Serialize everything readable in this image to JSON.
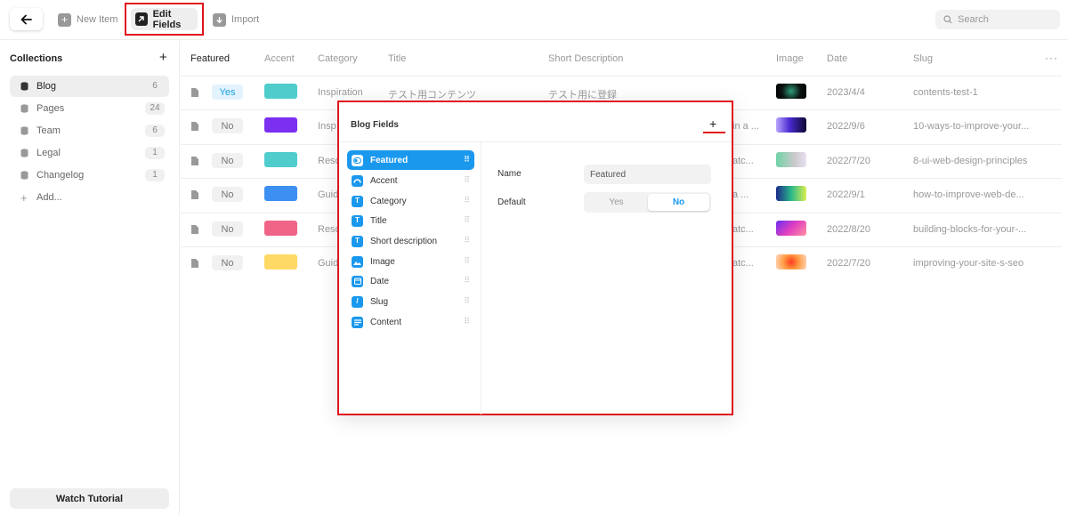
{
  "toolbar": {
    "new_item_label": "New Item",
    "edit_fields_label": "Edit Fields",
    "import_label": "Import",
    "search_placeholder": "Search"
  },
  "sidebar": {
    "heading": "Collections",
    "add_icon": "plus-icon",
    "items": [
      {
        "label": "Blog",
        "count": "6",
        "active": true
      },
      {
        "label": "Pages",
        "count": "24"
      },
      {
        "label": "Team",
        "count": "6"
      },
      {
        "label": "Legal",
        "count": "1"
      },
      {
        "label": "Changelog",
        "count": "1"
      },
      {
        "label": "Add..."
      }
    ],
    "watch_tutorial_label": "Watch Tutorial"
  },
  "table": {
    "columns": [
      "Featured",
      "Accent",
      "Category",
      "Title",
      "Short Description",
      "Image",
      "Date",
      "Slug"
    ],
    "rows": [
      {
        "featured": "Yes",
        "accent": "#4fcccc",
        "category": "Inspiration",
        "title": "テスト用コンテンツ",
        "short_description": "テスト用に登録",
        "image": "dark-sparkles",
        "date": "2023/4/4",
        "slug": "contents-test-1"
      },
      {
        "featured": "No",
        "accent": "#7b2ff0",
        "category": "Insp",
        "title": "",
        "short_description": "in a ...",
        "image": "purple-gradient",
        "date": "2022/9/6",
        "slug": "10-ways-to-improve-your..."
      },
      {
        "featured": "No",
        "accent": "#4fcccc",
        "category": "Reso",
        "title": "",
        "short_description": "atc...",
        "image": "teal-gradient",
        "date": "2022/7/20",
        "slug": "8-ui-web-design-principles"
      },
      {
        "featured": "No",
        "accent": "#3d8ff2",
        "category": "Guid",
        "title": "",
        "short_description": "a ...",
        "image": "green-gradient",
        "date": "2022/9/1",
        "slug": "how-to-improve-web-de..."
      },
      {
        "featured": "No",
        "accent": "#f06488",
        "category": "Reso",
        "title": "",
        "short_description": "atc...",
        "image": "pink-gradient",
        "date": "2022/8/20",
        "slug": "building-blocks-for-your-..."
      },
      {
        "featured": "No",
        "accent": "#ffd966",
        "category": "Guid",
        "title": "",
        "short_description": "atc...",
        "image": "orange-glow",
        "date": "2022/7/20",
        "slug": "improving-your-site-s-seo"
      }
    ]
  },
  "modal": {
    "title": "Blog Fields",
    "fields": [
      {
        "label": "Featured",
        "icon": "toggle-icon",
        "active": true
      },
      {
        "label": "Accent",
        "icon": "color-icon"
      },
      {
        "label": "Category",
        "icon": "text-icon"
      },
      {
        "label": "Title",
        "icon": "text-icon"
      },
      {
        "label": "Short description",
        "icon": "text-icon"
      },
      {
        "label": "Image",
        "icon": "image-icon"
      },
      {
        "label": "Date",
        "icon": "date-icon"
      },
      {
        "label": "Slug",
        "icon": "slug-icon"
      },
      {
        "label": "Content",
        "icon": "content-icon"
      }
    ],
    "properties": {
      "name_label": "Name",
      "name_value": "Featured",
      "default_label": "Default",
      "default_options": [
        "Yes",
        "No"
      ],
      "default_selected": "No"
    }
  },
  "colors": {
    "accent_blue": "#1a98ee",
    "highlight_red": "#e0141e"
  }
}
